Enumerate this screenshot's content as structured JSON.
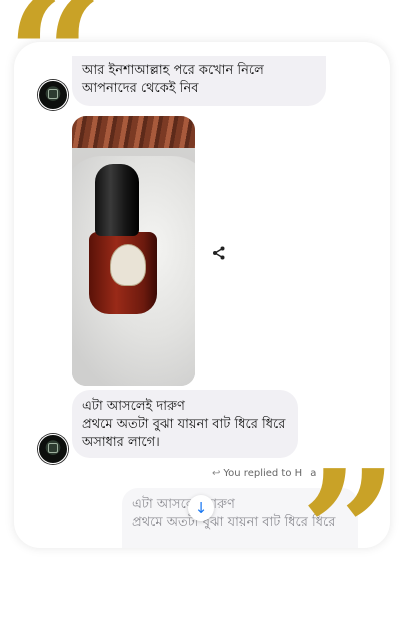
{
  "messages": {
    "first": {
      "line1": "আর ইনশাআল্লাহ পরে কখোন নিলে",
      "line2": "আপনাদের থেকেই নিব"
    },
    "second": {
      "line1": "এটা আসলেই দারুণ",
      "line2": "প্রথমে অতটা বুঝা যায়না বাট ধিরে ধিরে",
      "line3": "অসাধার লাগে।"
    }
  },
  "reply": {
    "label": "You replied to",
    "name": "Happ",
    "quoted_line1": "এটা আসলেই দারুণ",
    "quoted_line2": "প্রথমে অতটা বুঝা যায়না বাট ধিরে ধিরে"
  },
  "icons": {
    "share": "share-icon",
    "reply": "reply-arrow-icon",
    "scroll": "arrow-down-icon"
  },
  "colors": {
    "quote_mark": "#c9a227",
    "bubble": "#f1f0f4",
    "accent": "#1877f2"
  }
}
